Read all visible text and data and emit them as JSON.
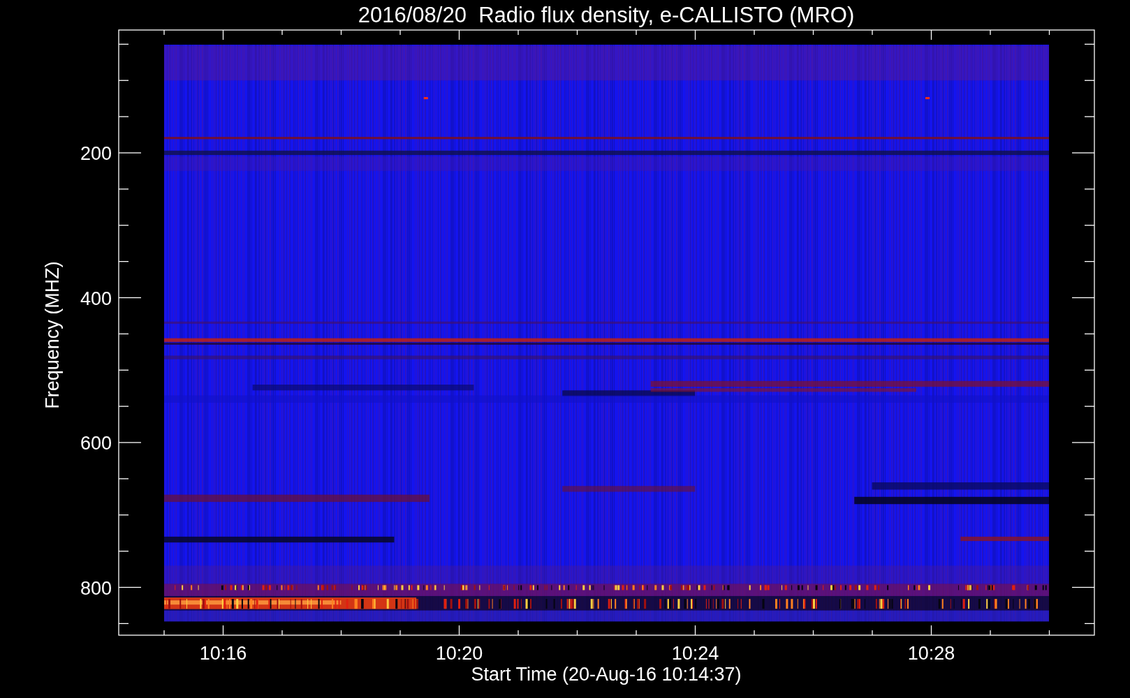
{
  "title": "2016/08/20  Radio flux density, e-CALLISTO (MRO)",
  "x_axis": {
    "label": "Start Time (20-Aug-16 10:14:37)",
    "ticks": [
      "10:16",
      "10:20",
      "10:24",
      "10:28"
    ]
  },
  "y_axis": {
    "label": "Frequency (MHZ)",
    "ticks": [
      "200",
      "400",
      "600",
      "800"
    ]
  }
}
